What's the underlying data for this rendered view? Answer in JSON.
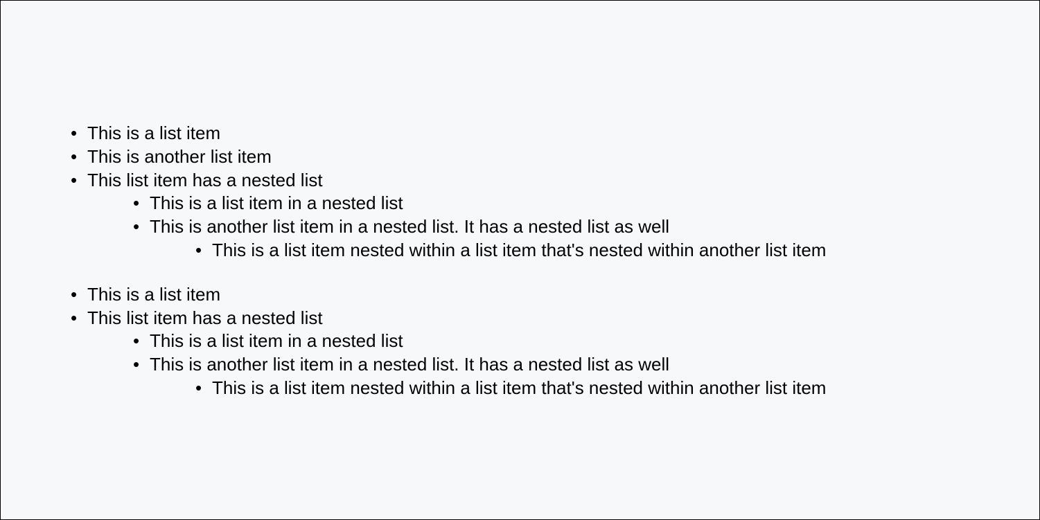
{
  "lists": [
    {
      "items": [
        {
          "text": "This is a list item"
        },
        {
          "text": "This is another list item"
        },
        {
          "text": "This list item has a nested list",
          "children": [
            {
              "text": "This is a list item in a nested list"
            },
            {
              "text": "This is another list item in a nested list. It has a nested list as well",
              "children": [
                {
                  "text": "This is a list item nested within a list item that's nested within another list item"
                }
              ]
            }
          ]
        }
      ]
    },
    {
      "items": [
        {
          "text": "This is a list item"
        },
        {
          "text": "This list item has a nested list",
          "children": [
            {
              "text": "This is a list item in a nested list"
            },
            {
              "text": "This is another list item in a nested list. It has a nested list as well",
              "children": [
                {
                  "text": "This is a list item nested within a list item that's nested within another list item"
                }
              ]
            }
          ]
        }
      ]
    }
  ]
}
